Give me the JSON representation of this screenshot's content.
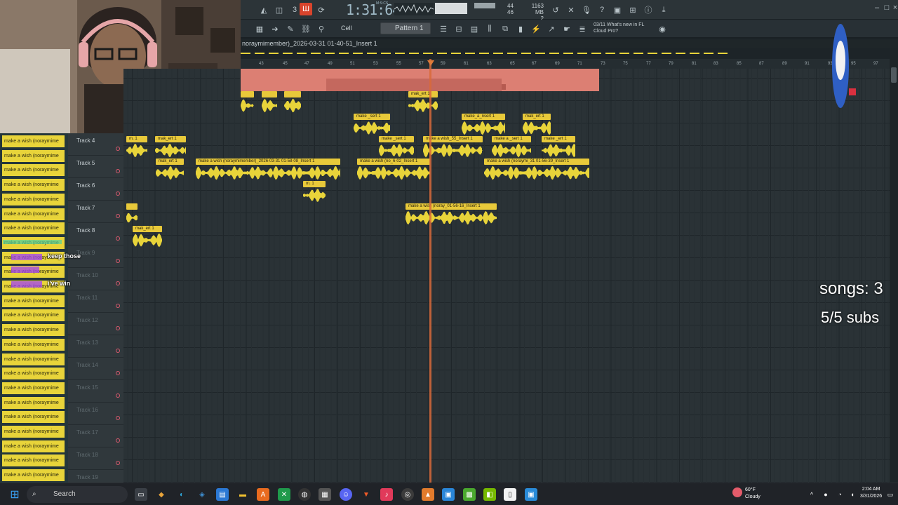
{
  "window": {
    "playlist_title": "noraymimember)_2026-03-31 01-40-51_Insert 1",
    "clock": "1:31:64",
    "clock_sub": "M:S:CS",
    "cpu_value": "44",
    "cpu_sub": "46",
    "memory": "1163 MB",
    "memory_sub": "2",
    "snap": "Cell",
    "pattern": "Pattern 1",
    "news_line1": "03/11  What's new in FL",
    "news_line2": "Cloud Pro?"
  },
  "ruler": [
    "43",
    "45",
    "47",
    "49",
    "51",
    "53",
    "55",
    "57",
    "59",
    "61",
    "63",
    "65",
    "67",
    "69",
    "71",
    "73",
    "75",
    "77",
    "79",
    "81",
    "83",
    "85",
    "87",
    "89",
    "91",
    "93",
    "95",
    "97"
  ],
  "tracks": [
    {
      "name": "Track 4",
      "empty": false
    },
    {
      "name": "Track 5",
      "empty": false
    },
    {
      "name": "Track 6",
      "empty": false
    },
    {
      "name": "Track 7",
      "empty": false
    },
    {
      "name": "Track 8",
      "empty": false
    },
    {
      "name": "Track 9",
      "empty": true
    },
    {
      "name": "Track 10",
      "empty": true
    },
    {
      "name": "Track 11",
      "empty": true
    },
    {
      "name": "Track 12",
      "empty": true
    },
    {
      "name": "Track 13",
      "empty": true
    },
    {
      "name": "Track 14",
      "empty": true
    },
    {
      "name": "Track 15",
      "empty": true
    },
    {
      "name": "Track 16",
      "empty": true
    },
    {
      "name": "Track 17",
      "empty": true
    },
    {
      "name": "Track 18",
      "empty": true
    },
    {
      "name": "Track 19",
      "empty": true
    }
  ],
  "clips": [
    {
      "label": "",
      "row": -2
    },
    {
      "label": "",
      "row": -2
    },
    {
      "label": "",
      "row": -2
    },
    {
      "label": "mak_ert 1",
      "row": -2
    },
    {
      "label": "make _sert 1",
      "row": -1
    },
    {
      "label": "make_a_nsert 1",
      "row": -1
    },
    {
      "label": "mak_ert 1",
      "row": -1
    },
    {
      "label": "m. 1",
      "row": 0
    },
    {
      "label": "mak_ert 1",
      "row": 0
    },
    {
      "label": "make _sert 1",
      "row": 0
    },
    {
      "label": "make a wish_55_Insert 1",
      "row": 0
    },
    {
      "label": "make a _sert 1",
      "row": 0
    },
    {
      "label": "make _ert 1",
      "row": 0
    },
    {
      "label": "mak_ert 1",
      "row": 1
    },
    {
      "label": "make a wish (noraymimember)_2026-03-31 01-58-08_Insert 1",
      "row": 1
    },
    {
      "label": "make a wish (no_6-02_Insert 1",
      "row": 1
    },
    {
      "label": "make a wish (noraymi_31 01-56-39_Insert 1",
      "row": 1
    },
    {
      "label": "m. 1",
      "row": 2
    },
    {
      "label": "",
      "row": 3
    },
    {
      "label": "make a wish (noray_01-56-16_Insert 1",
      "row": 3
    },
    {
      "label": "mak_ert 1",
      "row": 4
    }
  ],
  "browser_item": "make a wish (noraymime",
  "chat": [
    {
      "user": "",
      "text": "keep those"
    },
    {
      "user": "",
      "text": "i've win"
    }
  ],
  "overlay": {
    "songs": "songs: 3",
    "subs": "5/5 subs"
  },
  "taskbar": {
    "search": "Search",
    "weather_temp": "60°F",
    "weather_desc": "Cloudy",
    "time": "2:04 AM",
    "date": "3/31/2026"
  }
}
